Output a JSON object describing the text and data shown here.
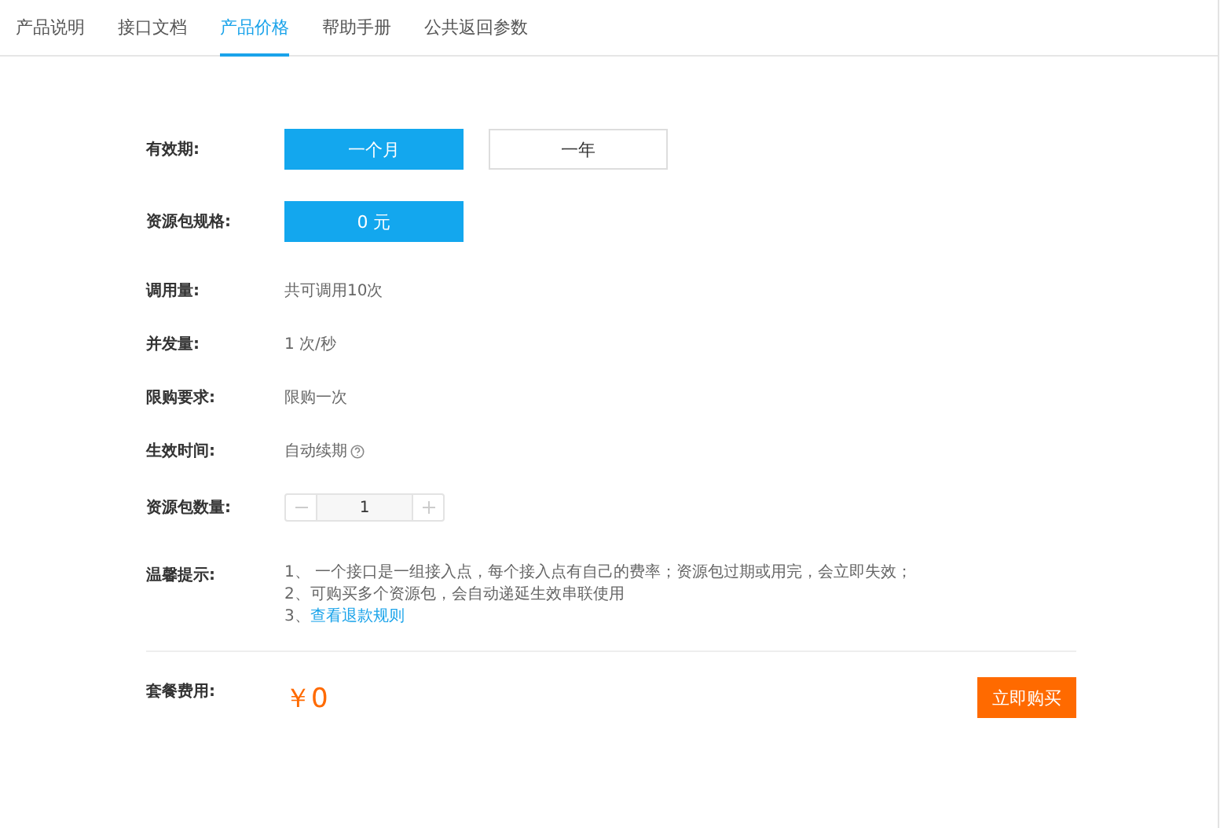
{
  "tabs": [
    {
      "label": "产品说明",
      "selected": false
    },
    {
      "label": "接口文档",
      "selected": false
    },
    {
      "label": "产品价格",
      "selected": true
    },
    {
      "label": "帮助手册",
      "selected": false
    },
    {
      "label": "公共返回参数",
      "selected": false
    }
  ],
  "validity": {
    "label": "有效期:",
    "options": [
      {
        "label": "一个月",
        "selected": true
      },
      {
        "label": "一年",
        "selected": false
      }
    ]
  },
  "package_spec": {
    "label": "资源包规格:",
    "options": [
      {
        "label": "0 元",
        "selected": true
      }
    ]
  },
  "info_rows": [
    {
      "label": "调用量:",
      "value": "共可调用10次",
      "help": false
    },
    {
      "label": "并发量:",
      "value": "1 次/秒",
      "help": false
    },
    {
      "label": "限购要求:",
      "value": "限购一次",
      "help": false
    },
    {
      "label": "生效时间:",
      "value": "自动续期",
      "help": true
    }
  ],
  "quantity": {
    "label": "资源包数量:",
    "value": "1"
  },
  "tips": {
    "label": "温馨提示:",
    "items": [
      {
        "kind": "text",
        "text": "1、 一个接口是一组接入点，每个接入点有自己的费率；资源包过期或用完，会立即失效；"
      },
      {
        "kind": "text",
        "text": "2、可购买多个资源包，会自动递延生效串联使用"
      },
      {
        "kind": "link",
        "prefix": "3、",
        "link": "查看退款规则"
      }
    ]
  },
  "fee": {
    "label": "套餐费用:",
    "price": "￥0",
    "button": "立即购买"
  }
}
